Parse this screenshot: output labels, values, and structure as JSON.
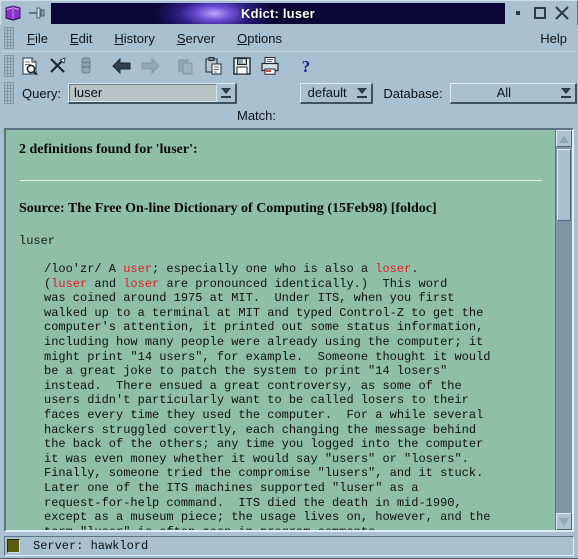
{
  "window": {
    "title": "Kdict: luser",
    "app_icon": "book-icon",
    "pin_icon": "pin-icon",
    "minimize_label": "·",
    "maximize_label": "□",
    "close_label": "✕"
  },
  "menubar": {
    "items": [
      {
        "label": "File",
        "name": "menu-file"
      },
      {
        "label": "Edit",
        "name": "menu-edit"
      },
      {
        "label": "History",
        "name": "menu-history"
      },
      {
        "label": "Server",
        "name": "menu-server"
      },
      {
        "label": "Options",
        "name": "menu-options"
      }
    ],
    "help_label": "Help"
  },
  "toolbar": {
    "buttons": [
      {
        "name": "define-icon",
        "tip": "Define"
      },
      {
        "name": "clear-icon",
        "tip": "Clear"
      },
      {
        "name": "stop-icon",
        "tip": "Stop"
      },
      {
        "name": "back-arrow-icon",
        "tip": "Back"
      },
      {
        "name": "forward-arrow-icon",
        "tip": "Forward"
      },
      {
        "name": "copy-icon",
        "tip": "Copy"
      },
      {
        "name": "paste-icon",
        "tip": "Paste"
      },
      {
        "name": "save-icon",
        "tip": "Save"
      },
      {
        "name": "print-icon",
        "tip": "Print"
      },
      {
        "name": "help-question-icon",
        "tip": "Help"
      }
    ]
  },
  "query": {
    "label": "Query:",
    "value": "luser",
    "placeholder": "",
    "strategy_value": "default",
    "database_label": "Database:",
    "database_value": "All",
    "match_label": "Match:"
  },
  "content": {
    "found_line": "2 definitions found for 'luser':",
    "source_line": "Source: The Free On-line Dictionary of Computing (15Feb98) [foldoc]",
    "headword": "luser",
    "definition_segments": [
      {
        "text": "/loo'zr/ A ",
        "link": false
      },
      {
        "text": "user",
        "link": true
      },
      {
        "text": "; especially one who is also a ",
        "link": false
      },
      {
        "text": "loser",
        "link": true
      },
      {
        "text": ".\n(",
        "link": false
      },
      {
        "text": "luser",
        "link": true
      },
      {
        "text": " and ",
        "link": false
      },
      {
        "text": "loser",
        "link": true
      },
      {
        "text": " are pronounced identically.)  This word\nwas coined around 1975 at MIT.  Under ITS, when you first\nwalked up to a terminal at MIT and typed Control-Z to get the\ncomputer's attention, it printed out some status information,\nincluding how many people were already using the computer; it\nmight print \"14 users\", for example.  Someone thought it would\nbe a great joke to patch the system to print \"14 losers\"\ninstead.  There ensued a great controversy, as some of the\nusers didn't particularly want to be called losers to their\nfaces every time they used the computer.  For a while several\nhackers struggled covertly, each changing the message behind\nthe back of the others; any time you logged into the computer\nit was even money whether it would say \"users\" or \"losers\".\nFinally, someone tried the compromise \"lusers\", and it stuck.\nLater one of the ITS machines supported \"luser\" as a\nrequest-for-help command.  ITS died the death in mid-1990,\nexcept as a museum piece; the usage lives on, however, and the\nterm \"luser\" is often seen in program comments.",
        "link": false
      }
    ],
    "link_color": "#e02020",
    "background_color": "#8fbfa9"
  },
  "scrollbar": {
    "up_arrow": "scroll-up-arrow-icon",
    "down_arrow": "scroll-down-arrow-icon"
  },
  "statusbar": {
    "text": "Server: hawklord",
    "led_name": "connection-led"
  },
  "colors": {
    "chrome": "#a8c0d0",
    "content_bg": "#8fbfa9",
    "title_accent": "#6d4fd6",
    "link": "#e02020",
    "status_led": "#5a5a10"
  }
}
